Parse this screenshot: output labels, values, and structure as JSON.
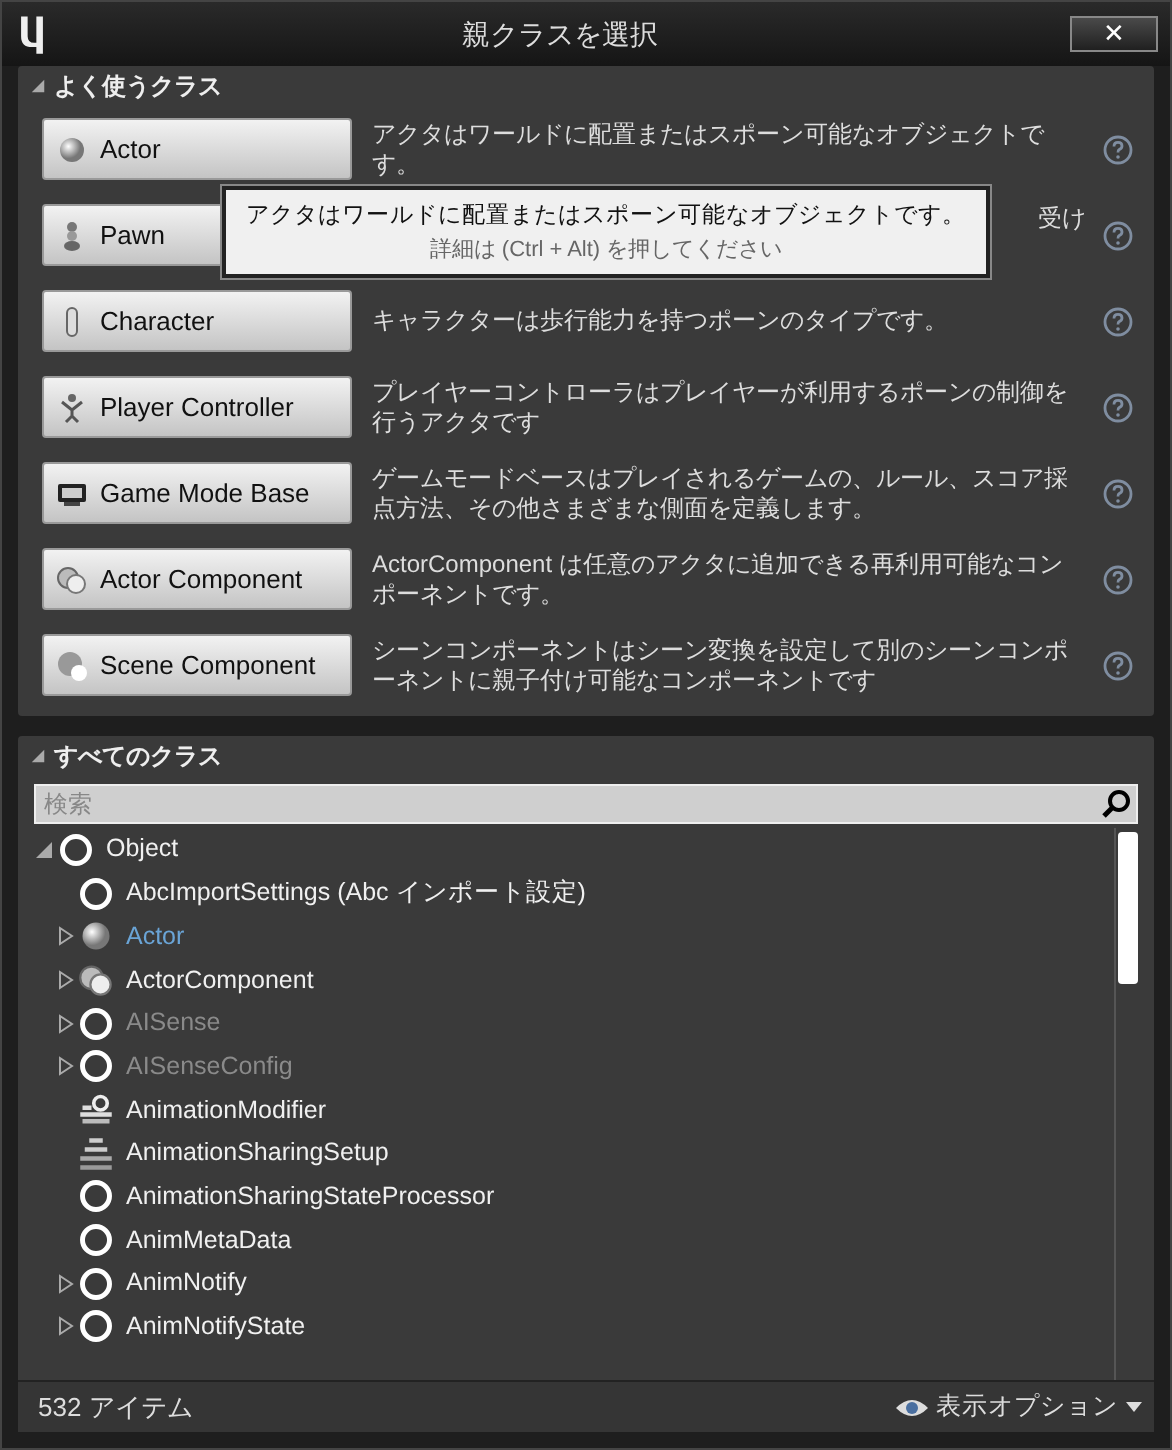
{
  "window": {
    "title": "親クラスを選択",
    "close": "✕"
  },
  "common": {
    "title": "よく使うクラス",
    "expanded": true,
    "items": [
      {
        "label": "Actor",
        "kind": "sphere",
        "description": "アクタはワールドに配置またはスポーン可能なオブジェクトです。",
        "covered": false
      },
      {
        "label": "Pawn",
        "kind": "pawn",
        "description": "受け",
        "covered": true
      },
      {
        "label": "Character",
        "kind": "capsule",
        "description": "キャラクターは歩行能力を持つポーンのタイプです。",
        "covered": false
      },
      {
        "label": "Player Controller",
        "kind": "controller",
        "description": "プレイヤーコントローラはプレイヤーが利用するポーンの制御を行うアクタです",
        "covered": false
      },
      {
        "label": "Game Mode Base",
        "kind": "monitor",
        "description": "ゲームモードベースはプレイされるゲームの、ルール、スコア採点方法、その他さまざまな側面を定義します。",
        "covered": false
      },
      {
        "label": "Actor Component",
        "kind": "component",
        "description": "ActorComponent は任意のアクタに追加できる再利用可能なコンポーネントです。",
        "covered": false
      },
      {
        "label": "Scene Component",
        "kind": "scene",
        "description": "シーンコンポーネントはシーン変換を設定して別のシーンコンポーネントに親子付け可能なコンポーネントです",
        "covered": false
      }
    ]
  },
  "tooltip": {
    "text": "アクタはワールドに配置またはスポーン可能なオブジェクトです。",
    "hint": "詳細は (Ctrl + Alt) を押してください"
  },
  "all": {
    "title": "すべてのクラス",
    "expanded": true,
    "search": {
      "placeholder": "検索"
    },
    "tree": [
      {
        "label": "Object",
        "kind": "circle",
        "selected": false,
        "disabled": false,
        "expanded": true,
        "children": [
          {
            "label": "AbcImportSettings (Abc インポート設定)",
            "kind": "circle",
            "selected": false,
            "disabled": false
          },
          {
            "label": "Actor",
            "kind": "sphere",
            "selected": true,
            "disabled": false,
            "expanded": false
          },
          {
            "label": "ActorComponent",
            "kind": "component",
            "selected": false,
            "disabled": false,
            "expanded": false
          },
          {
            "label": "AISense",
            "kind": "circle",
            "selected": false,
            "disabled": true,
            "expanded": false
          },
          {
            "label": "AISenseConfig",
            "kind": "circle",
            "selected": false,
            "disabled": true,
            "expanded": false
          },
          {
            "label": "AnimationModifier",
            "kind": "modifier",
            "selected": false,
            "disabled": false
          },
          {
            "label": "AnimationSharingSetup",
            "kind": "grid",
            "selected": false,
            "disabled": false
          },
          {
            "label": "AnimationSharingStateProcessor",
            "kind": "circle",
            "selected": false,
            "disabled": false
          },
          {
            "label": "AnimMetaData",
            "kind": "circle",
            "selected": false,
            "disabled": false
          },
          {
            "label": "AnimNotify",
            "kind": "circle",
            "selected": false,
            "disabled": false,
            "expanded": false
          },
          {
            "label": "AnimNotifyState",
            "kind": "circle",
            "selected": false,
            "disabled": false,
            "expanded": false
          }
        ]
      }
    ]
  },
  "status_bar": {
    "count": "532 アイテム",
    "view_options": "表示オプション"
  }
}
